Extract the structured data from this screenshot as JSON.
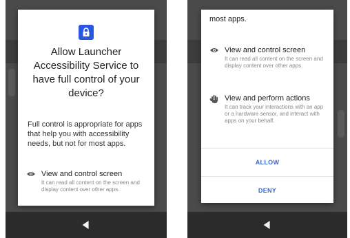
{
  "left": {
    "title": "Allow Launcher Accessibility Service to have full control of your device?",
    "body": "Full control is appropriate for apps that help you with accessibility needs, but not for most apps.",
    "permission": {
      "icon": "eye-icon",
      "title": "View and control screen",
      "description": "It can read all content on the screen and display content over other apps."
    }
  },
  "right": {
    "top_text": "most apps.",
    "permissions": [
      {
        "icon": "eye-icon",
        "title": "View and control screen",
        "description": "It can read all content on the screen and display content over other apps."
      },
      {
        "icon": "hand-icon",
        "title": "View and perform actions",
        "description": "It can track your interactions with an app or a hardware sensor, and interact with apps on your behalf."
      }
    ],
    "allow_label": "ALLOW",
    "deny_label": "DENY"
  },
  "colors": {
    "accent": "#3a66d4",
    "lock_badge": "#2a57e0",
    "scrim": "#4a4a4a",
    "navbar": "#2b2b2b"
  }
}
